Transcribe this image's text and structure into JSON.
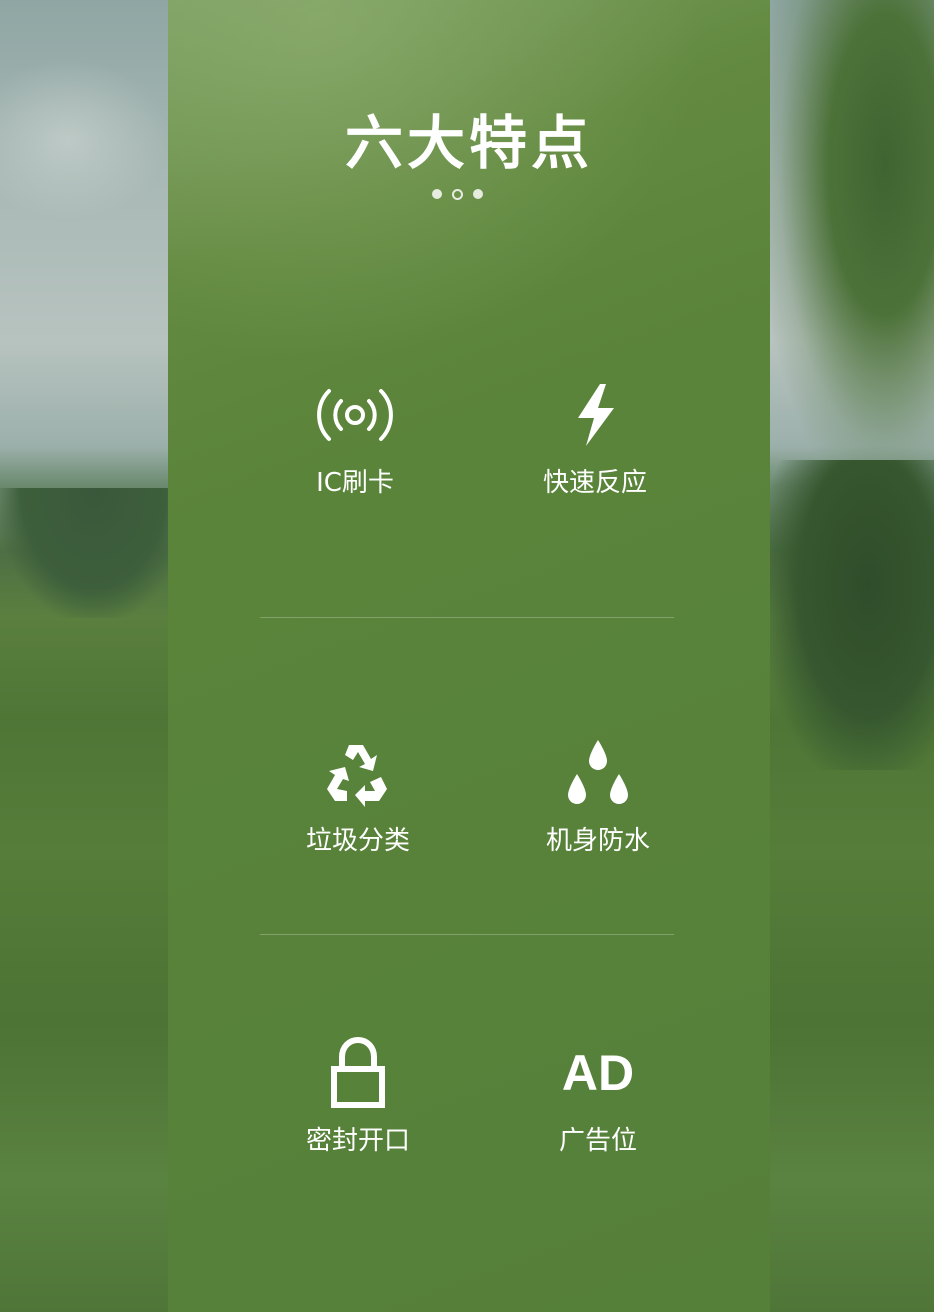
{
  "title": "六大特点",
  "features": [
    {
      "label": "IC刷卡",
      "icon": "rfid-signal-icon"
    },
    {
      "label": "快速反应",
      "icon": "lightning-bolt-icon"
    },
    {
      "label": "垃圾分类",
      "icon": "recycle-icon"
    },
    {
      "label": "机身防水",
      "icon": "water-drops-icon"
    },
    {
      "label": "密封开口",
      "icon": "padlock-icon"
    },
    {
      "label": "广告位",
      "icon": "ad-icon",
      "icon_text": "AD"
    }
  ],
  "colors": {
    "panel": "#5a843a",
    "text": "#ffffff"
  }
}
